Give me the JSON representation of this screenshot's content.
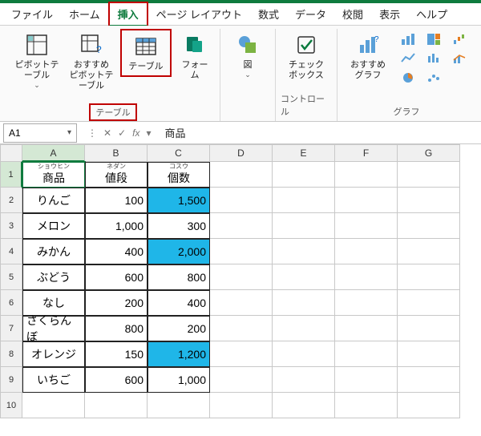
{
  "menu": {
    "file": "ファイル",
    "home": "ホーム",
    "insert": "挿入",
    "pagelayout": "ページ レイアウト",
    "formulas": "数式",
    "data": "データ",
    "review": "校閲",
    "view": "表示",
    "help": "ヘルプ"
  },
  "ribbon": {
    "pivot": "ピボットテーブル",
    "recommend_pivot": "おすすめ\nピボットテーブル",
    "table": "テーブル",
    "form": "フォーム",
    "illustrations": "図",
    "checkbox": "チェック\nボックス",
    "recommend_chart": "おすすめ\nグラフ",
    "group_tables": "テーブル",
    "group_controls": "コントロール",
    "group_charts": "グラフ",
    "dropdown": "⌄"
  },
  "namebox": "A1",
  "formula_value": "商品",
  "cols": {
    "A": "A",
    "B": "B",
    "C": "C",
    "D": "D",
    "E": "E",
    "F": "F",
    "G": "G"
  },
  "headers": {
    "product": "商品",
    "product_ruby": "ショウヒン",
    "price": "値段",
    "price_ruby": "ネダン",
    "qty": "個数",
    "qty_ruby": "コスウ"
  },
  "rows": [
    {
      "n": "1"
    },
    {
      "n": "2",
      "p": "りんご",
      "price": "100",
      "qty": "1,500",
      "hl": true
    },
    {
      "n": "3",
      "p": "メロン",
      "price": "1,000",
      "qty": "300"
    },
    {
      "n": "4",
      "p": "みかん",
      "price": "400",
      "qty": "2,000",
      "hl": true
    },
    {
      "n": "5",
      "p": "ぶどう",
      "price": "600",
      "qty": "800"
    },
    {
      "n": "6",
      "p": "なし",
      "price": "200",
      "qty": "400"
    },
    {
      "n": "7",
      "p": "さくらんぼ",
      "price": "800",
      "qty": "200"
    },
    {
      "n": "8",
      "p": "オレンジ",
      "price": "150",
      "qty": "1,200",
      "hl": true
    },
    {
      "n": "9",
      "p": "いちご",
      "price": "600",
      "qty": "1,000"
    },
    {
      "n": "10"
    }
  ]
}
